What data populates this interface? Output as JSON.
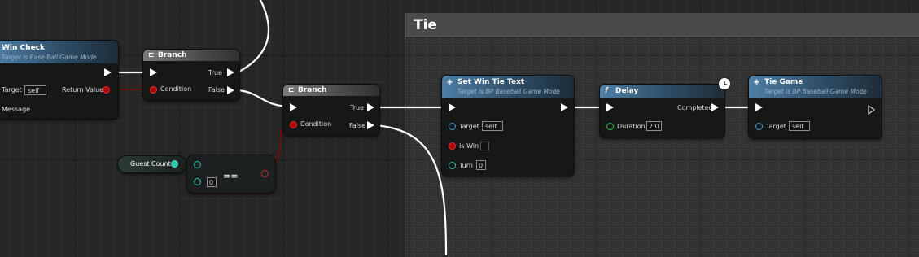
{
  "comment": {
    "title": "Tie"
  },
  "win_check": {
    "title": "Win Check",
    "subtitle": "Target is Base Ball Game Mode",
    "target_label": "Target",
    "target_value": "self",
    "return_value_label": "Return Value",
    "message_label": "Message"
  },
  "branch1": {
    "icon": "branch-icon",
    "title": "Branch",
    "condition_label": "Condition",
    "true_label": "True",
    "false_label": "False"
  },
  "branch2": {
    "icon": "branch-icon",
    "title": "Branch",
    "condition_label": "Condition",
    "true_label": "True",
    "false_label": "False"
  },
  "guest_count": {
    "label": "Guest Count"
  },
  "equals": {
    "operator": "==",
    "value": "0"
  },
  "set_win_tie_text": {
    "icon": "function-icon",
    "title": "Set Win Tie Text",
    "subtitle": "Target is BP Baseball Game Mode",
    "target_label": "Target",
    "target_value": "self",
    "is_win_label": "Is Win",
    "turn_label": "Turn",
    "turn_value": "0"
  },
  "delay": {
    "icon": "f-icon",
    "title": "Delay",
    "completed_label": "Completed",
    "duration_label": "Duration",
    "duration_value": "2.0",
    "latent_icon": "clock-icon"
  },
  "tie_game": {
    "icon": "function-icon",
    "title": "Tie Game",
    "subtitle": "Target is BP Baseball Game Mode",
    "target_label": "Target",
    "target_value": "self"
  },
  "colors": {
    "exec": "#ffffff",
    "boolean": "#b00000",
    "object": "#3a9be0",
    "float": "#2fbf3f",
    "integer": "#2ec4a8",
    "function_header": "#4f7fa6",
    "flow_header": "#7a7a7a"
  }
}
